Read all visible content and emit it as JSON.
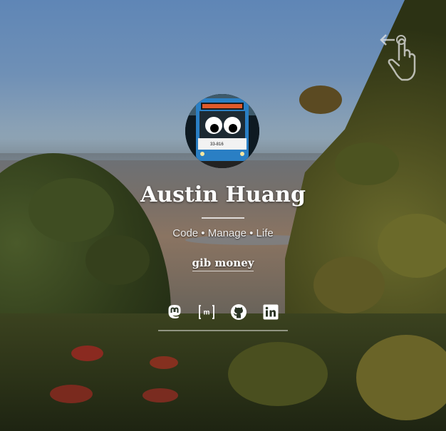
{
  "profile": {
    "name": "Austin Huang",
    "tagline": "Code • Manage • Life",
    "link_label": "gib money",
    "avatar": "bus-with-googly-eyes",
    "bus_number": "33-816"
  },
  "social": [
    {
      "name": "mastodon",
      "icon": "mastodon-icon"
    },
    {
      "name": "matrix",
      "icon": "matrix-icon",
      "glyph": "[m]"
    },
    {
      "name": "github",
      "icon": "github-icon"
    },
    {
      "name": "linkedin",
      "icon": "linkedin-icon"
    }
  ],
  "hint": {
    "icon": "swipe-hand-icon"
  },
  "colors": {
    "text": "#ffffff",
    "sky": "#6f90b6",
    "foliage": "#3b421f",
    "bus_blue": "#2a7fc4"
  }
}
